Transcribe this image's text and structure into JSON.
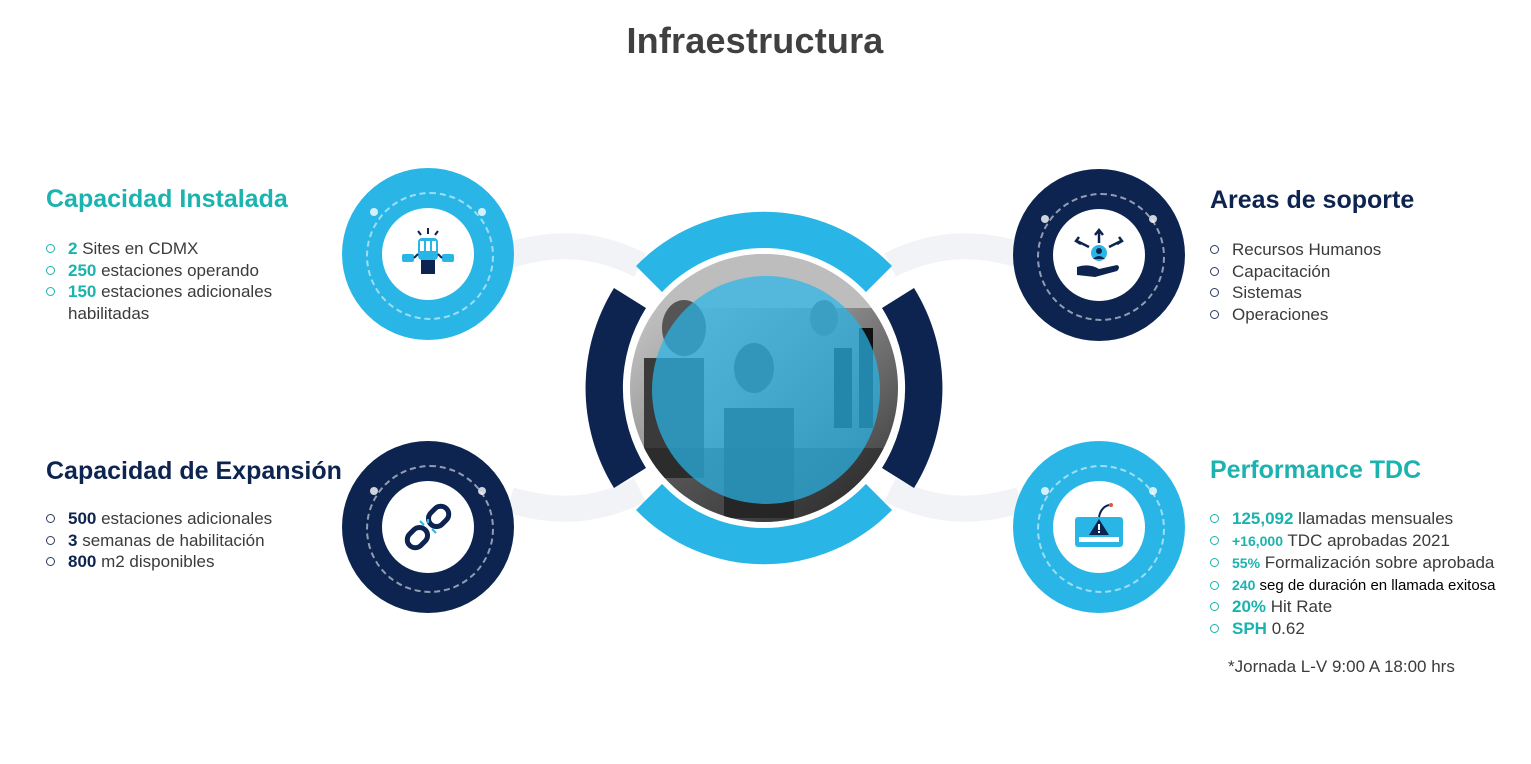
{
  "title": "Infraestructura",
  "sections": {
    "capacidad_instalada": {
      "heading": "Capacidad Instalada",
      "items": [
        {
          "num": "2",
          "text": " Sites en CDMX"
        },
        {
          "num": "250",
          "text": " estaciones operando"
        },
        {
          "num": "150",
          "text": " estaciones adicionales"
        }
      ],
      "continuation": "habilitadas"
    },
    "capacidad_expansion": {
      "heading": "Capacidad de Expansión",
      "items": [
        {
          "num": "500",
          "text": " estaciones adicionales"
        },
        {
          "num": "3",
          "text": " semanas de habilitación"
        },
        {
          "num": "800",
          "text": " m2 disponibles"
        }
      ]
    },
    "areas_soporte": {
      "heading": "Areas de soporte",
      "items": [
        "Recursos Humanos",
        "Capacitación",
        "Sistemas",
        "Operaciones"
      ]
    },
    "performance_tdc": {
      "heading": "Performance TDC",
      "items": [
        {
          "num": "125,092",
          "text": " llamadas mensuales"
        },
        {
          "num": "+16,000",
          "text": " TDC aprobadas 2021"
        },
        {
          "num": "55%",
          "text": " Formalización sobre aprobada"
        },
        {
          "num": "240",
          "text": " seg de duración en llamada exitosa"
        },
        {
          "num": "20%",
          "text": "  Hit Rate"
        },
        {
          "num": "SPH",
          "text": " 0.62"
        }
      ],
      "footnote": "*Jornada L-V 9:00 A 18:00 hrs"
    }
  },
  "icons": {
    "capacidad_instalada": "raised-fist-icon",
    "capacidad_expansion": "broken-chain-icon",
    "areas_soporte": "support-hand-icon",
    "performance_tdc": "alert-device-icon",
    "center": "call-center-photo"
  },
  "colors": {
    "teal": "#1ab3b0",
    "cyan": "#29b6e6",
    "navy": "#0d2450",
    "text": "#3b3b3b",
    "title": "#404040"
  }
}
